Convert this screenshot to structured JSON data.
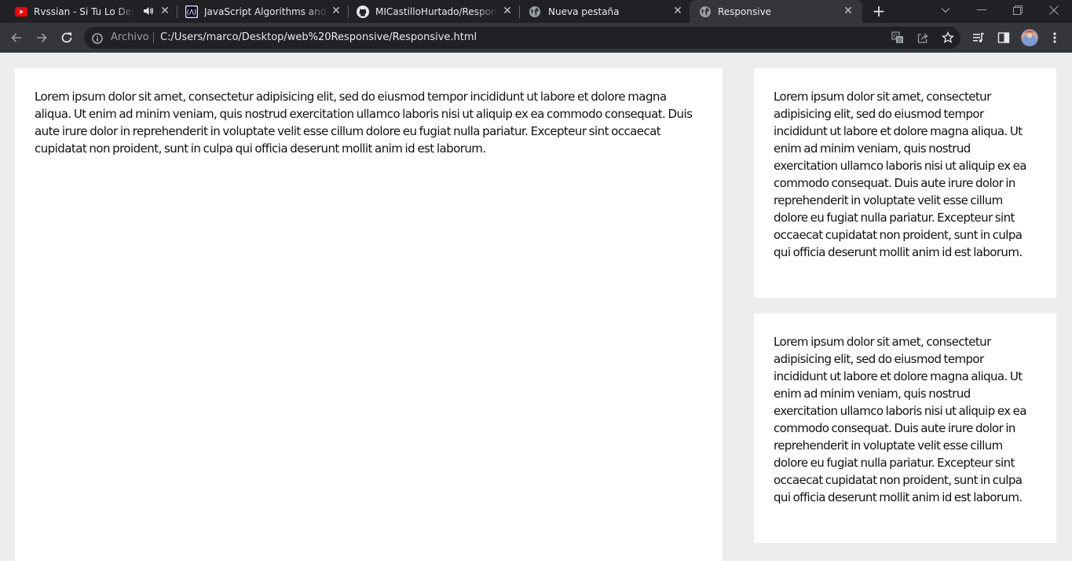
{
  "tabs": [
    {
      "title": "Rvssian - Si Tu Lo Dejas F",
      "icon": "youtube-icon",
      "audio_icon": "speaker-icon"
    },
    {
      "title": "JavaScript Algorithms and Da",
      "icon": "freecodecamp-icon"
    },
    {
      "title": "MICastilloHurtado/Responsiv",
      "icon": "github-icon"
    },
    {
      "title": "Nueva pestaña",
      "icon": "globe-icon"
    },
    {
      "title": "Responsive",
      "icon": "globe-icon",
      "active": true
    }
  ],
  "address_bar": {
    "security_label": "Archivo",
    "url": "C:/Users/marco/Desktop/web%20Responsive/Responsive.html"
  },
  "page": {
    "main_text": "Lorem ipsum dolor sit amet, consectetur adipisicing elit, sed do eiusmod tempor incididunt ut labore et dolore magna aliqua. Ut enim ad minim veniam, quis nostrud exercitation ullamco laboris nisi ut aliquip ex ea commodo consequat. Duis aute irure dolor in reprehenderit in voluptate velit esse cillum dolore eu fugiat nulla pariatur. Excepteur sint occaecat cupidatat non proident, sunt in culpa qui officia deserunt mollit anim id est laborum.",
    "side_text_1": "Lorem ipsum dolor sit amet, consectetur adipisicing elit, sed do eiusmod tempor incididunt ut labore et dolore magna aliqua. Ut enim ad minim veniam, quis nostrud exercitation ullamco laboris nisi ut aliquip ex ea commodo consequat. Duis aute irure dolor in reprehenderit in voluptate velit esse cillum dolore eu fugiat nulla pariatur. Excepteur sint occaecat cupidatat non proident, sunt in culpa qui officia deserunt mollit anim id est laborum.",
    "side_text_2": "Lorem ipsum dolor sit amet, consectetur adipisicing elit, sed do eiusmod tempor incididunt ut labore et dolore magna aliqua. Ut enim ad minim veniam, quis nostrud exercitation ullamco laboris nisi ut aliquip ex ea commodo consequat. Duis aute irure dolor in reprehenderit in voluptate velit esse cillum dolore eu fugiat nulla pariatur. Excepteur sint occaecat cupidatat non proident, sunt in culpa qui officia deserunt mollit anim id est laborum."
  },
  "colors": {
    "tabstrip_bg": "#202124",
    "toolbar_bg": "#35363a",
    "page_bg": "#ededed",
    "card_bg": "#ffffff",
    "youtube_red": "#ff0000"
  }
}
